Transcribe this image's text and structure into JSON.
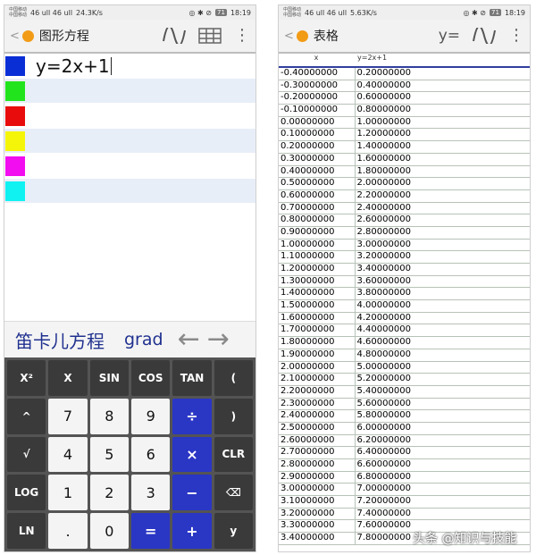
{
  "left": {
    "status": {
      "carrier1": "中国移动",
      "carrier2": "中国移动",
      "network_signal": "46 ull 46 ull",
      "speed": "24.3K/s",
      "status_icons": "◎ ✱ ⊘",
      "battery": "71",
      "time": "18:19"
    },
    "appbar": {
      "back": "<",
      "title": "图形方程"
    },
    "equations": [
      {
        "color": "#0a2ed6",
        "text": "y=2x+1"
      },
      {
        "color": "#22e41c",
        "text": ""
      },
      {
        "color": "#e80c0c",
        "text": ""
      },
      {
        "color": "#f5f50a",
        "text": ""
      },
      {
        "color": "#f20cf0",
        "text": ""
      },
      {
        "color": "#10f2f2",
        "text": ""
      }
    ],
    "mode": {
      "label": "笛卡儿方程",
      "unit": "grad",
      "prev": "←",
      "next": "→"
    },
    "keys": [
      {
        "label": "X²",
        "style": "dark"
      },
      {
        "label": "X",
        "style": "dark"
      },
      {
        "label": "SIN",
        "style": "dark"
      },
      {
        "label": "COS",
        "style": "dark"
      },
      {
        "label": "TAN",
        "style": "dark"
      },
      {
        "label": "(",
        "style": "dark"
      },
      {
        "label": "^",
        "style": "dark"
      },
      {
        "label": "7",
        "style": "light"
      },
      {
        "label": "8",
        "style": "light"
      },
      {
        "label": "9",
        "style": "light"
      },
      {
        "label": "÷",
        "style": "blue"
      },
      {
        "label": ")",
        "style": "dark"
      },
      {
        "label": "√",
        "style": "dark"
      },
      {
        "label": "4",
        "style": "light"
      },
      {
        "label": "5",
        "style": "light"
      },
      {
        "label": "6",
        "style": "light"
      },
      {
        "label": "×",
        "style": "blue"
      },
      {
        "label": "CLR",
        "style": "dark"
      },
      {
        "label": "LOG",
        "style": "dark"
      },
      {
        "label": "1",
        "style": "light"
      },
      {
        "label": "2",
        "style": "light"
      },
      {
        "label": "3",
        "style": "light"
      },
      {
        "label": "−",
        "style": "blue"
      },
      {
        "label": "⌫",
        "style": "dark"
      },
      {
        "label": "LN",
        "style": "dark"
      },
      {
        "label": ".",
        "style": "light"
      },
      {
        "label": "0",
        "style": "light"
      },
      {
        "label": "=",
        "style": "blue"
      },
      {
        "label": "+",
        "style": "blue"
      },
      {
        "label": "y",
        "style": "dark"
      }
    ]
  },
  "right": {
    "status": {
      "carrier1": "中国移动",
      "carrier2": "中国移动",
      "network_signal": "46 ull 46 ull",
      "speed": "5.63K/s",
      "status_icons": "◎ ✱ ⊘",
      "battery": "71",
      "time": "18:19"
    },
    "appbar": {
      "back": "<",
      "title": "表格",
      "y_label": "y="
    },
    "table": {
      "headers": [
        "x",
        "y=2x+1"
      ],
      "rows": [
        [
          "-0.40000000",
          "0.20000000"
        ],
        [
          "-0.30000000",
          "0.40000000"
        ],
        [
          "-0.20000000",
          "0.60000000"
        ],
        [
          "-0.10000000",
          "0.80000000"
        ],
        [
          "0.00000000",
          "1.00000000"
        ],
        [
          "0.10000000",
          "1.20000000"
        ],
        [
          "0.20000000",
          "1.40000000"
        ],
        [
          "0.30000000",
          "1.60000000"
        ],
        [
          "0.40000000",
          "1.80000000"
        ],
        [
          "0.50000000",
          "2.00000000"
        ],
        [
          "0.60000000",
          "2.20000000"
        ],
        [
          "0.70000000",
          "2.40000000"
        ],
        [
          "0.80000000",
          "2.60000000"
        ],
        [
          "0.90000000",
          "2.80000000"
        ],
        [
          "1.00000000",
          "3.00000000"
        ],
        [
          "1.10000000",
          "3.20000000"
        ],
        [
          "1.20000000",
          "3.40000000"
        ],
        [
          "1.30000000",
          "3.60000000"
        ],
        [
          "1.40000000",
          "3.80000000"
        ],
        [
          "1.50000000",
          "4.00000000"
        ],
        [
          "1.60000000",
          "4.20000000"
        ],
        [
          "1.70000000",
          "4.40000000"
        ],
        [
          "1.80000000",
          "4.60000000"
        ],
        [
          "1.90000000",
          "4.80000000"
        ],
        [
          "2.00000000",
          "5.00000000"
        ],
        [
          "2.10000000",
          "5.20000000"
        ],
        [
          "2.20000000",
          "5.40000000"
        ],
        [
          "2.30000000",
          "5.60000000"
        ],
        [
          "2.40000000",
          "5.80000000"
        ],
        [
          "2.50000000",
          "6.00000000"
        ],
        [
          "2.60000000",
          "6.20000000"
        ],
        [
          "2.70000000",
          "6.40000000"
        ],
        [
          "2.80000000",
          "6.60000000"
        ],
        [
          "2.90000000",
          "6.80000000"
        ],
        [
          "3.00000000",
          "7.00000000"
        ],
        [
          "3.10000000",
          "7.20000000"
        ],
        [
          "3.20000000",
          "7.40000000"
        ],
        [
          "3.30000000",
          "7.60000000"
        ],
        [
          "3.40000000",
          "7.80000000"
        ]
      ]
    }
  },
  "watermark": "头条 @知识与技能"
}
